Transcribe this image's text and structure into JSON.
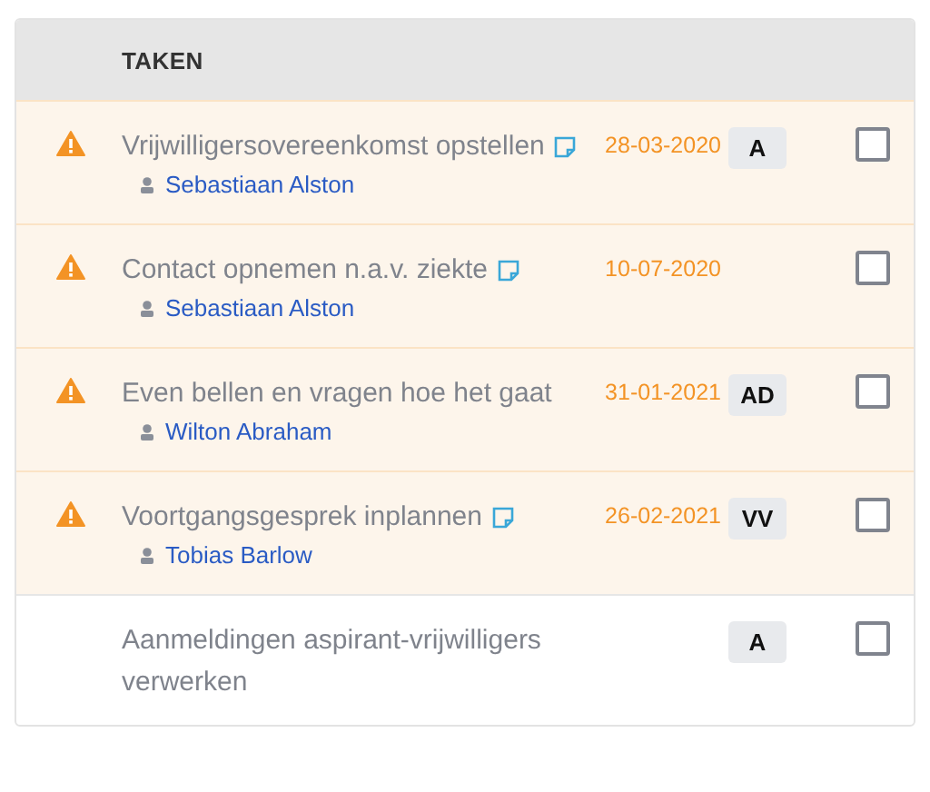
{
  "table": {
    "columns": [
      {
        "label": "TAKEN"
      }
    ],
    "rows": [
      {
        "overdue": true,
        "title": "Vrijwilligersovereenkomst opstellen",
        "has_note": true,
        "assignee": "Sebastiaan Alston",
        "date": "28-03-2020",
        "badge": "A",
        "checked": false
      },
      {
        "overdue": true,
        "title": "Contact opnemen n.a.v. ziekte",
        "has_note": true,
        "assignee": "Sebastiaan Alston",
        "date": "10-07-2020",
        "checked": false
      },
      {
        "overdue": true,
        "title": "Even bellen en vragen hoe het gaat",
        "has_note": false,
        "assignee": "Wilton Abraham",
        "date": "31-01-2021",
        "badge": "AD",
        "checked": false
      },
      {
        "overdue": true,
        "title": "Voortgangsgesprek inplannen",
        "has_note": true,
        "assignee": "Tobias Barlow",
        "date": "26-02-2021",
        "badge": "VV",
        "checked": false
      },
      {
        "overdue": false,
        "title": "Aanmeldingen aspirant-vrijwilligers verwerken",
        "has_note": false,
        "badge": "A",
        "checked": false
      }
    ]
  }
}
